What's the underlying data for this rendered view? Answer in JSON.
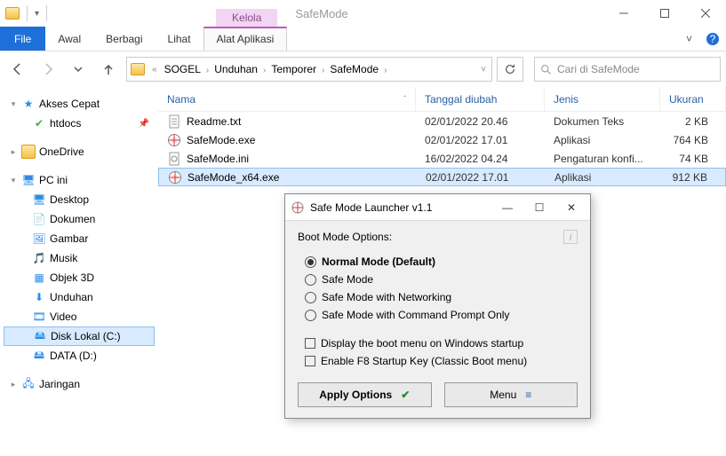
{
  "titlebar": {
    "contextual_tab": "Kelola",
    "app_title": "SafeMode"
  },
  "ribbon": {
    "file": "File",
    "tabs": [
      "Awal",
      "Berbagi",
      "Lihat",
      "Alat Aplikasi"
    ],
    "active_index": 3
  },
  "breadcrumb": {
    "parts": [
      "SOGEL",
      "Unduhan",
      "Temporer",
      "SafeMode"
    ]
  },
  "search": {
    "placeholder": "Cari di SafeMode"
  },
  "sidebar": {
    "quick_access": "Akses Cepat",
    "quick_items": [
      {
        "label": "htdocs",
        "pinned": true
      }
    ],
    "onedrive": "OneDrive",
    "this_pc": "PC ini",
    "pc_items": [
      "Desktop",
      "Dokumen",
      "Gambar",
      "Musik",
      "Objek 3D",
      "Unduhan",
      "Video",
      "Disk Lokal (C:)",
      "DATA (D:)"
    ],
    "pc_selected_index": 7,
    "network": "Jaringan"
  },
  "columns": {
    "name": "Nama",
    "date": "Tanggal diubah",
    "type": "Jenis",
    "size": "Ukuran"
  },
  "files": [
    {
      "name": "Readme.txt",
      "date": "02/01/2022 20.46",
      "type": "Dokumen Teks",
      "size": "2 KB",
      "icon": "txt"
    },
    {
      "name": "SafeMode.exe",
      "date": "02/01/2022 17.01",
      "type": "Aplikasi",
      "size": "764 KB",
      "icon": "exe"
    },
    {
      "name": "SafeMode.ini",
      "date": "16/02/2022 04.24",
      "type": "Pengaturan konfi...",
      "size": "74 KB",
      "icon": "ini"
    },
    {
      "name": "SafeMode_x64.exe",
      "date": "02/01/2022 17.01",
      "type": "Aplikasi",
      "size": "912 KB",
      "icon": "exe"
    }
  ],
  "selected_file_index": 3,
  "dialog": {
    "title": "Safe Mode Launcher v1.1",
    "section": "Boot Mode Options:",
    "radios": [
      "Normal Mode (Default)",
      "Safe Mode",
      "Safe Mode with Networking",
      "Safe Mode with Command Prompt Only"
    ],
    "radio_selected": 0,
    "checks": [
      "Display the boot menu on Windows startup",
      "Enable F8 Startup Key (Classic Boot menu)"
    ],
    "apply": "Apply Options",
    "menu": "Menu"
  }
}
